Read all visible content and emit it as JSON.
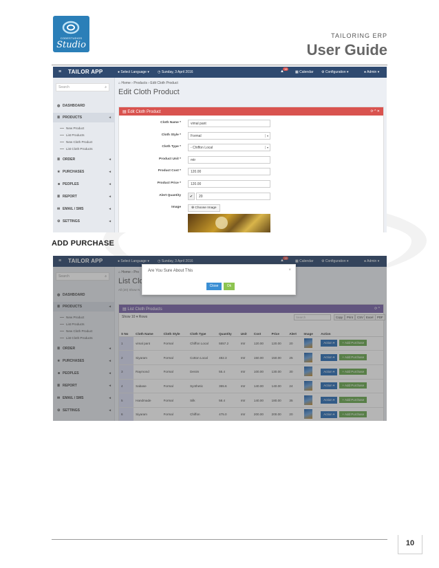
{
  "logo": {
    "small_text": "CODESTUDIOS",
    "big_text": "Studio"
  },
  "header": {
    "subtitle": "TAILORING ERP",
    "title": "User Guide"
  },
  "page_number": "10",
  "section_heading": "ADD PURCHASE",
  "app": {
    "brand": "TAILOR APP",
    "menu_icon": "≡",
    "language": "Select Language",
    "date": "Sunday, 3 April 2016",
    "notif_count": "15",
    "calendar": "Calendar",
    "configuration": "Configuration",
    "admin": "Admin"
  },
  "sidebar": {
    "search_placeholder": "Search",
    "items": [
      {
        "label": "DASHBOARD",
        "icon": "dashboard-icon"
      },
      {
        "label": "PRODUCTS",
        "icon": "list-icon"
      },
      {
        "label": "ORDER",
        "icon": "list-icon"
      },
      {
        "label": "PURCHASES",
        "icon": "star-icon"
      },
      {
        "label": "PEOPLES",
        "icon": "users-icon"
      },
      {
        "label": "REPORT",
        "icon": "list-icon"
      },
      {
        "label": "EMAIL / SMS",
        "icon": "mail-icon"
      },
      {
        "label": "SETTINGS",
        "icon": "cogs-icon"
      }
    ],
    "sub_items": [
      "New Product",
      "List Products",
      "New Cloth Product",
      "List Cloth Products"
    ]
  },
  "shot1": {
    "breadcrumb": [
      "Home",
      "Products",
      "Edit Cloth Product"
    ],
    "page_title": "Edit Cloth Product",
    "panel_title": "Edit Cloth Product",
    "panel_color": "#d9534f",
    "form": [
      {
        "label": "Cloth Name *",
        "value": "vimal pant",
        "type": "text"
      },
      {
        "label": "Cloth Style *",
        "value": "Formal",
        "type": "select"
      },
      {
        "label": "Cloth Type *",
        "value": "- Chiffon Local",
        "type": "select"
      },
      {
        "label": "Product Unit *",
        "value": "mtr",
        "type": "text"
      },
      {
        "label": "Product Cost *",
        "value": "120.00",
        "type": "text"
      },
      {
        "label": "Product Price *",
        "value": "120.00",
        "type": "text"
      },
      {
        "label": "Alert Quantity",
        "value": "20",
        "type": "check"
      },
      {
        "label": "Image",
        "value": "Choose Image",
        "type": "file"
      }
    ]
  },
  "shot2": {
    "breadcrumb": [
      "Home",
      "Pro"
    ],
    "page_title": "List Cloth",
    "page_sub": "All (20) Show N",
    "modal": {
      "title": "Are You Sure About This",
      "close": "Close",
      "ok": "Ok"
    },
    "panel_title": "List Cloth Products",
    "panel_color": "#7a64a8",
    "show_label": "Show",
    "show_value": "10",
    "rows_label": "Rows",
    "search_placeholder": "Search",
    "export_buttons": [
      "Copy",
      "Print",
      "CSV",
      "Excel",
      "PDF"
    ],
    "columns": [
      "S No",
      "Cloth Name",
      "Cloth Style",
      "Cloth Type",
      "Quantity",
      "Unit",
      "Cost",
      "Price",
      "Alert",
      "Image",
      "Action"
    ],
    "rows": [
      [
        "1",
        "vimal pant",
        "Formal",
        "Chiffon Local",
        "5557.2",
        "mtr",
        "120.00",
        "120.00",
        "20"
      ],
      [
        "2",
        "Siyaram",
        "Formal",
        "Cotton Local",
        "482.3",
        "mtr",
        "150.00",
        "150.00",
        "25"
      ],
      [
        "3",
        "Raymond",
        "Formal",
        "Denim",
        "55.4",
        "mtr",
        "100.00",
        "130.00",
        "30"
      ],
      [
        "4",
        "Sabase",
        "Formal",
        "Synthetic",
        "355.6",
        "mtr",
        "140.00",
        "140.00",
        "24"
      ],
      [
        "5",
        "Handmade",
        "Formal",
        "Silk",
        "58.4",
        "mtr",
        "140.00",
        "180.00",
        "35"
      ],
      [
        "6",
        "Siyaram",
        "Formal",
        "Chiffon",
        "475.0",
        "mtr",
        "200.00",
        "200.00",
        "20"
      ]
    ],
    "action_label": "Action",
    "add_purchase_label": "Add Purchase"
  }
}
